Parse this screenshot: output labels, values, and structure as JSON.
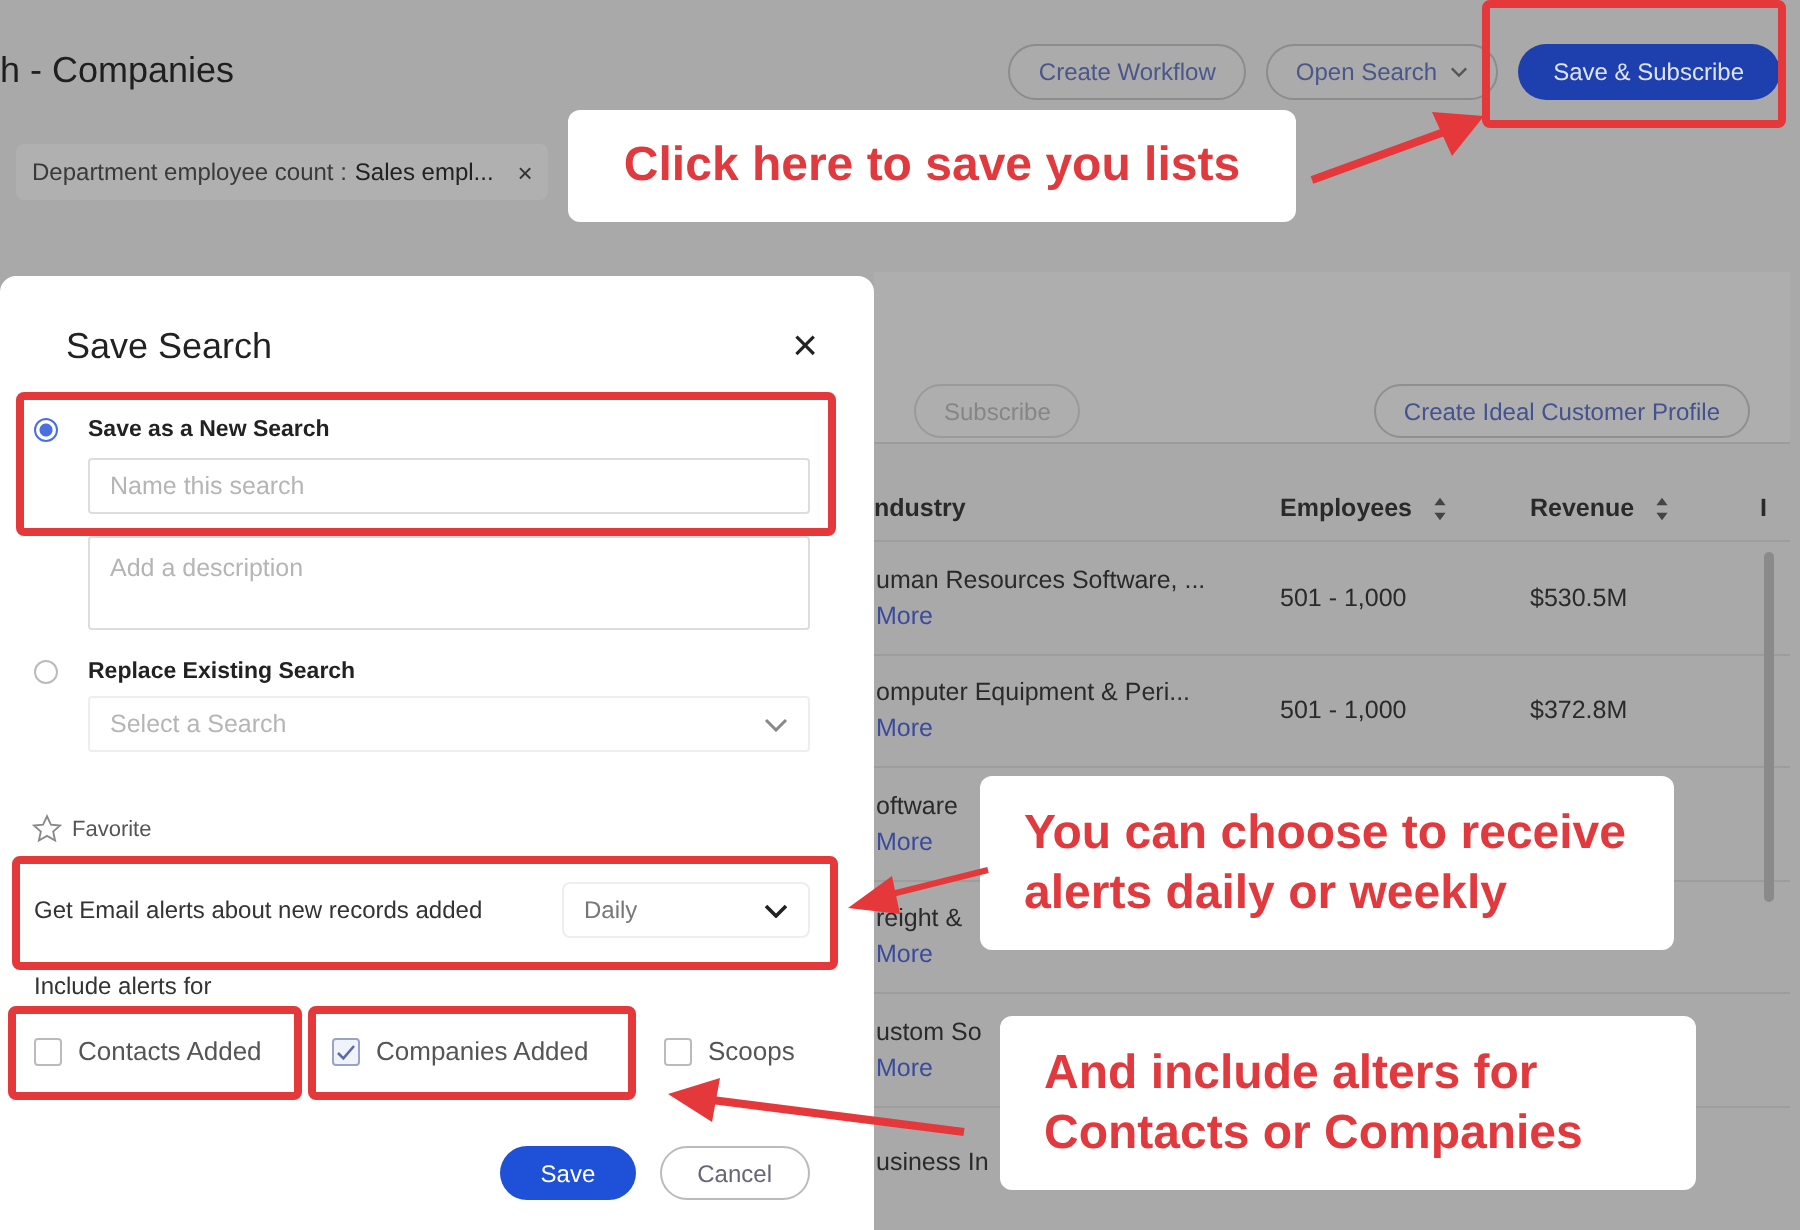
{
  "page": {
    "title": "h - Companies",
    "buttons": [
      {
        "label": "Create Workflow",
        "kind": "outline"
      },
      {
        "label": "Open Search",
        "kind": "dropdown"
      },
      {
        "label": "Save & Subscribe",
        "kind": "primary"
      }
    ],
    "filter_chip": {
      "label": "Department employee count :",
      "value": "Sales empl...",
      "remove": "×"
    },
    "toolbar": [
      {
        "label": "Subscribe",
        "disabled": true
      },
      {
        "label": "Create Ideal Customer Profile",
        "disabled": false
      }
    ],
    "table": {
      "columns": [
        {
          "label": "ndustry",
          "sortable": false
        },
        {
          "label": "Employees",
          "sortable": true
        },
        {
          "label": "Revenue",
          "sortable": true
        },
        {
          "label": "I",
          "sortable": false
        }
      ],
      "rows": [
        {
          "industry": "uman Resources Software, ...",
          "more": "More",
          "employees": "501 - 1,000",
          "revenue": "$530.5M"
        },
        {
          "industry": "omputer Equipment & Peri...",
          "more": "More",
          "employees": "501 - 1,000",
          "revenue": "$372.8M"
        },
        {
          "industry": "oftware",
          "more": "More"
        },
        {
          "industry": "reight &",
          "more": "More"
        },
        {
          "industry": "ustom So",
          "more": "More"
        },
        {
          "industry": "usiness In"
        }
      ]
    }
  },
  "dialog": {
    "title": "Save Search",
    "close": "×",
    "options": [
      {
        "label": "Save as a New Search",
        "selected": true
      },
      {
        "label": "Replace Existing Search",
        "selected": false
      }
    ],
    "name_field": {
      "placeholder": "Name this search"
    },
    "description_field": {
      "placeholder": "Add a description"
    },
    "replace_select": {
      "placeholder": "Select a Search"
    },
    "favorite": {
      "label": "Favorite",
      "checked": false
    },
    "email_alerts": {
      "label": "Get Email alerts about new records added",
      "value": "Daily"
    },
    "include_label": "Include alerts for",
    "alert_types": [
      {
        "label": "Contacts Added",
        "checked": false
      },
      {
        "label": "Companies Added",
        "checked": true
      },
      {
        "label": "Scoops",
        "checked": false
      }
    ],
    "buttons": [
      {
        "label": "Save",
        "kind": "primary"
      },
      {
        "label": "Cancel",
        "kind": "secondary"
      }
    ]
  },
  "annotations": [
    {
      "text": "Click here to save you lists"
    },
    {
      "text": "You can choose to receive alerts daily or weekly"
    },
    {
      "text": "And include alters for Contacts or Companies"
    }
  ]
}
